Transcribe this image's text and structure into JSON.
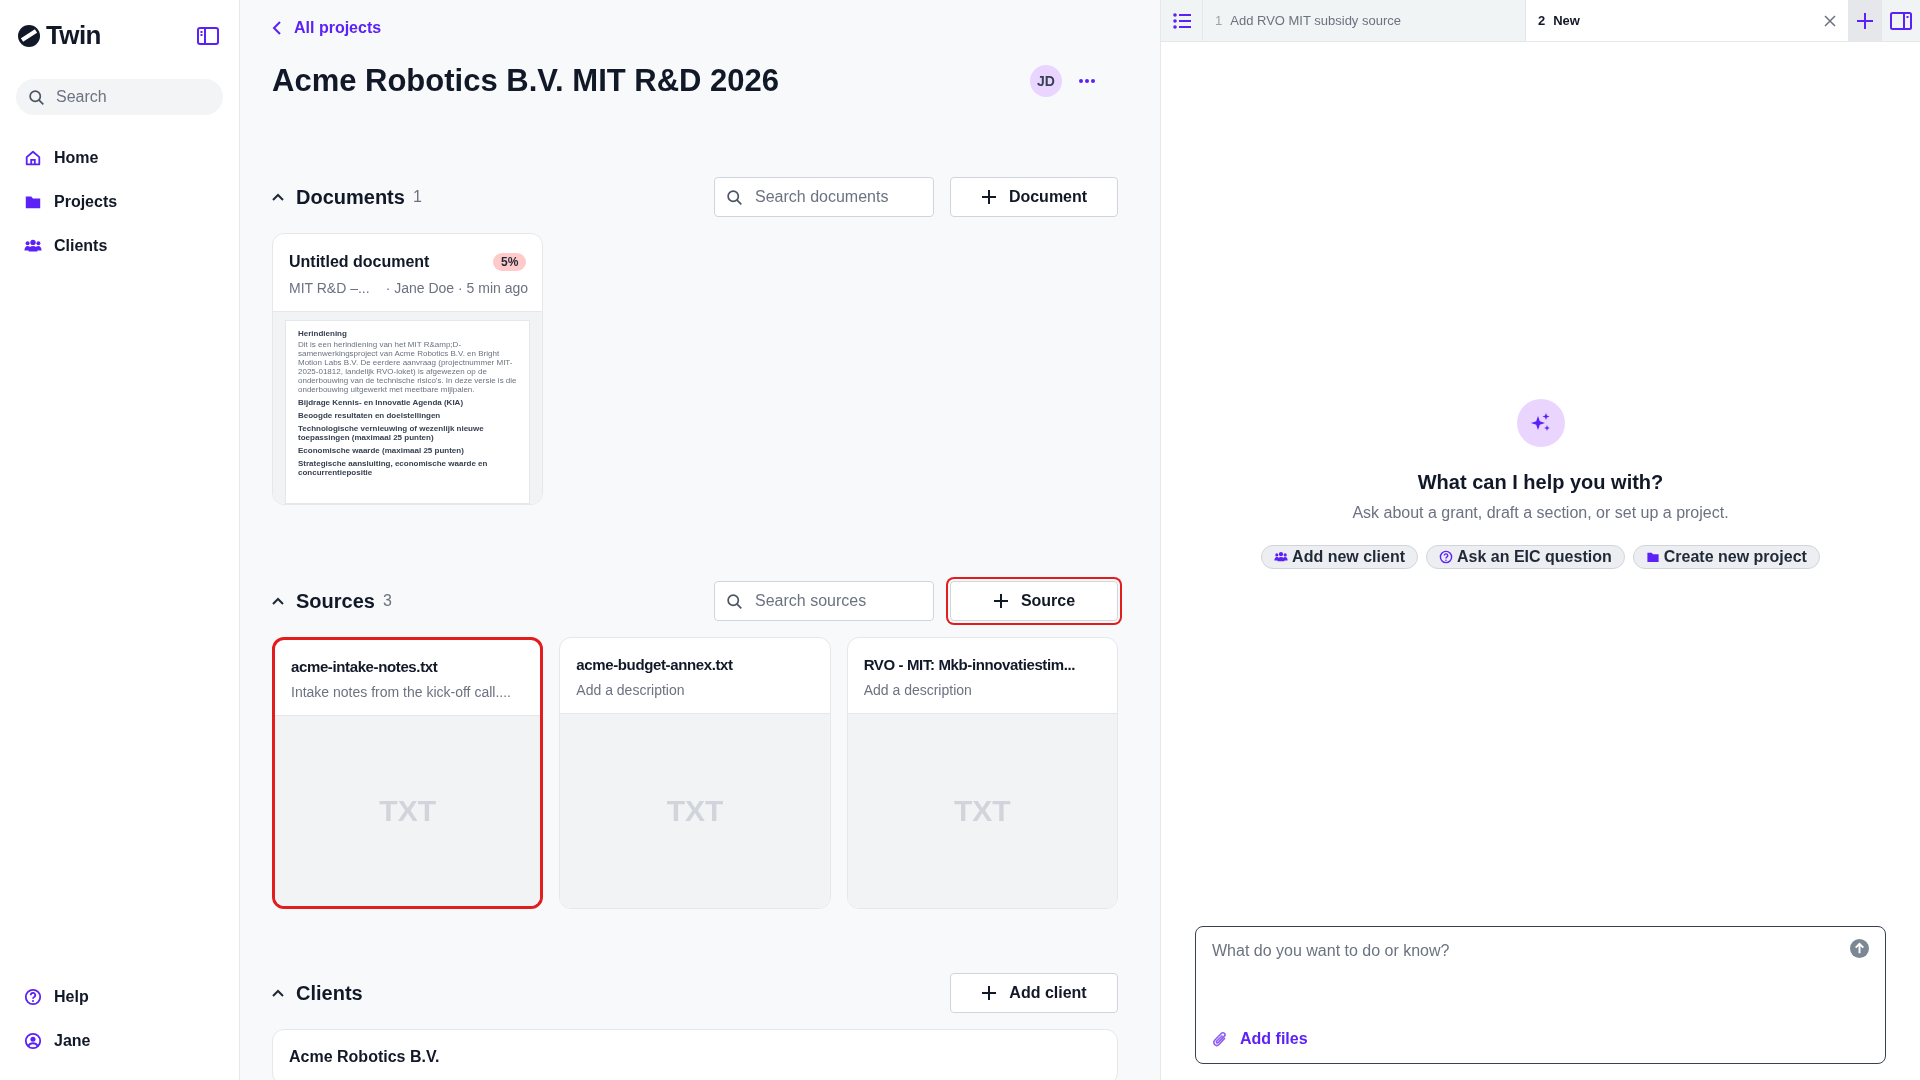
{
  "sidebar": {
    "brand": "Twin",
    "search": {
      "placeholder": "Search"
    },
    "nav": [
      {
        "label": "Home"
      },
      {
        "label": "Projects"
      },
      {
        "label": "Clients"
      }
    ],
    "footer": [
      {
        "label": "Help"
      },
      {
        "label": "Jane"
      }
    ]
  },
  "header": {
    "back_link": "All projects",
    "title": "Acme Robotics B.V. MIT R&D 2026",
    "avatar": "JD"
  },
  "documents": {
    "title": "Documents",
    "count": "1",
    "search": {
      "placeholder": "Search documents"
    },
    "add_button": "Document",
    "items": [
      {
        "title": "Untitled document",
        "progress": "5%",
        "project": "MIT R&D –...",
        "meta": "· Jane Doe · 5 min ago",
        "preview": [
          {
            "kind": "heading",
            "text": "Herindiening"
          },
          {
            "kind": "body",
            "text": "Dit is een herindiening van het MIT R&amp;D-samenwerkingsproject van Acme Robotics B.V. en Bright Motion Labs B.V. De eerdere aanvraag (projectnummer MIT-2025-01812, landelijk RVO-loket) is afgewezen op de onderbouwing van de technische risico's. In deze versie is die onderbouwing uitgewerkt met meetbare mijlpalen."
          },
          {
            "kind": "heading",
            "text": "Bijdrage Kennis- en Innovatie Agenda (KIA)"
          },
          {
            "kind": "heading",
            "text": "Beoogde resultaten en doelstellingen"
          },
          {
            "kind": "heading",
            "text": "Technologische vernieuwing of wezenlijk nieuwe toepassingen (maximaal 25 punten)"
          },
          {
            "kind": "heading",
            "text": "Economische waarde (maximaal 25 punten)"
          },
          {
            "kind": "heading",
            "text": "Strategische aansluiting, economische waarde en concurrentiepositie"
          }
        ]
      }
    ]
  },
  "sources": {
    "title": "Sources",
    "count": "3",
    "search": {
      "placeholder": "Search sources"
    },
    "add_button": "Source",
    "add_highlighted": true,
    "items": [
      {
        "name": "acme-intake-notes.txt",
        "description": "Intake notes from the kick-off call....",
        "type": "TXT",
        "highlighted": true
      },
      {
        "name": "acme-budget-annex.txt",
        "description": "Add a description",
        "type": "TXT",
        "highlighted": false
      },
      {
        "name": "RVO - MIT: Mkb-innovatiestim...",
        "description": "Add a description",
        "type": "TXT",
        "highlighted": false
      }
    ]
  },
  "clients": {
    "title": "Clients",
    "add_button": "Add client",
    "items": [
      "Acme Robotics B.V."
    ]
  },
  "assistant": {
    "tabs": [
      {
        "number": "1",
        "label": "Add RVO MIT subsidy source",
        "selected": false
      },
      {
        "number": "2",
        "label": "New",
        "selected": true
      }
    ],
    "heading": "What can I help you with?",
    "subtitle": "Ask about a grant, draft a section, or set up a project.",
    "suggestions": [
      {
        "label": "Add new client"
      },
      {
        "label": "Ask an EIC question"
      },
      {
        "label": "Create new project"
      }
    ],
    "input": {
      "placeholder": "What do you want to do or know?"
    },
    "add_files": "Add files"
  }
}
